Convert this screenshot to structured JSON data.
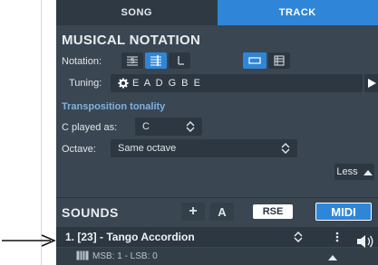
{
  "tabs": {
    "song": "SONG",
    "track": "TRACK"
  },
  "notation": {
    "title": "MUSICAL NOTATION",
    "label": "Notation:",
    "active_view": "tab",
    "buttons": [
      "standard-notation-icon",
      "tab-notation-icon",
      "slash-notation-icon",
      "single-view-icon",
      "multi-view-icon"
    ]
  },
  "tuning": {
    "label": "Tuning:",
    "value": "E A D G B E"
  },
  "transposition": {
    "title": "Transposition tonality",
    "c_played_as_label": "C played as:",
    "c_played_as_value": "C",
    "octave_label": "Octave:",
    "octave_value": "Same octave"
  },
  "less_button": {
    "label": "Less"
  },
  "sounds": {
    "title": "SOUNDS",
    "add_label": "+",
    "automation_label": "A",
    "rse_label": "RSE",
    "midi_label": "MIDI",
    "active_mode": "MIDI"
  },
  "track_sound": {
    "name": "1. [23] - Tango Accordion",
    "msb_lsb": "MSB: 1 - LSB: 0"
  },
  "colors": {
    "panel_bg": "#3a4651",
    "accent_blue": "#2f86d8",
    "subtitle_blue": "#7fb2e3"
  }
}
